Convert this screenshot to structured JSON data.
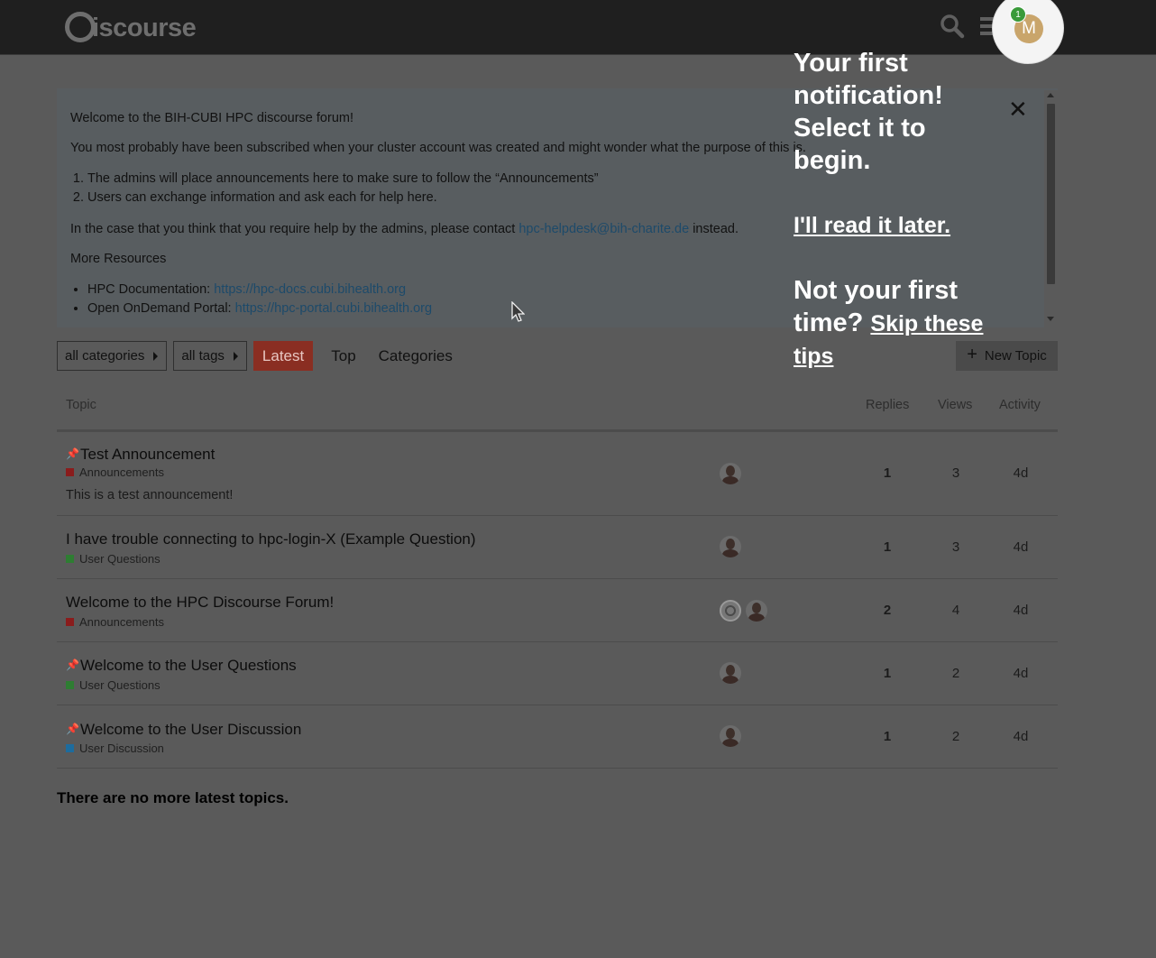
{
  "header": {
    "logo_text": "iscourse",
    "avatar_letter": "M",
    "notification_count": "1",
    "icons": [
      "search-icon",
      "hamburger-menu-icon"
    ]
  },
  "banner": {
    "welcome": "Welcome to the BIH-CUBI HPC discourse forum!",
    "subscribed": "You most probably have been subscribed when your cluster account was created and might wonder what the purpose of this is.",
    "list": [
      "The admins will place announcements here to make sure to follow the “Announcements”",
      "Users can exchange information and ask each for help here."
    ],
    "contact_before": "In the case that you think that you require help by the admins, please contact ",
    "contact_email": "hpc-helpdesk@bih-charite.de",
    "contact_after": " instead.",
    "more_resources": "More Resources",
    "resources": [
      {
        "label": "HPC Documentation: ",
        "url": "https://hpc-docs.cubi.bihealth.org"
      },
      {
        "label": "Open OnDemand Portal: ",
        "url": "https://hpc-portal.cubi.bihealth.org"
      }
    ],
    "close_glyph": "✕"
  },
  "nav": {
    "categories_dropdown": "all categories",
    "tags_dropdown": "all tags",
    "tabs": [
      "Latest",
      "Top",
      "Categories"
    ],
    "new_topic": "New Topic"
  },
  "table": {
    "headers": {
      "topic": "Topic",
      "replies": "Replies",
      "views": "Views",
      "activity": "Activity"
    },
    "rows": [
      {
        "title": "Test Announcement",
        "pinned": true,
        "category": "Announcements",
        "category_color": "#8a1c1c",
        "excerpt": "This is a test announcement!",
        "replies": "1",
        "views": "3",
        "activity": "4d"
      },
      {
        "title": "I have trouble connecting to hpc-login-X (Example Question)",
        "pinned": false,
        "category": "User Questions",
        "category_color": "#2e7d32",
        "excerpt": "",
        "replies": "1",
        "views": "3",
        "activity": "4d"
      },
      {
        "title": "Welcome to the HPC Discourse Forum!",
        "pinned": false,
        "category": "Announcements",
        "category_color": "#8a1c1c",
        "excerpt": "",
        "replies": "2",
        "views": "4",
        "activity": "4d"
      },
      {
        "title": "Welcome to the User Questions",
        "pinned": true,
        "category": "User Questions",
        "category_color": "#2e7d32",
        "excerpt": "",
        "replies": "1",
        "views": "2",
        "activity": "4d"
      },
      {
        "title": "Welcome to the User Discussion",
        "pinned": true,
        "category": "User Discussion",
        "category_color": "#1d6c9e",
        "excerpt": "",
        "replies": "1",
        "views": "2",
        "activity": "4d"
      }
    ],
    "footer": "There are no more latest topics."
  },
  "tip": {
    "lines": [
      "Your first",
      "notification!",
      "Select it to",
      "begin."
    ],
    "read_later": "I'll read it later.",
    "not_first_1": "Not your first",
    "not_first_2": "time? ",
    "skip_1": "Skip these",
    "skip_2": "tips"
  }
}
